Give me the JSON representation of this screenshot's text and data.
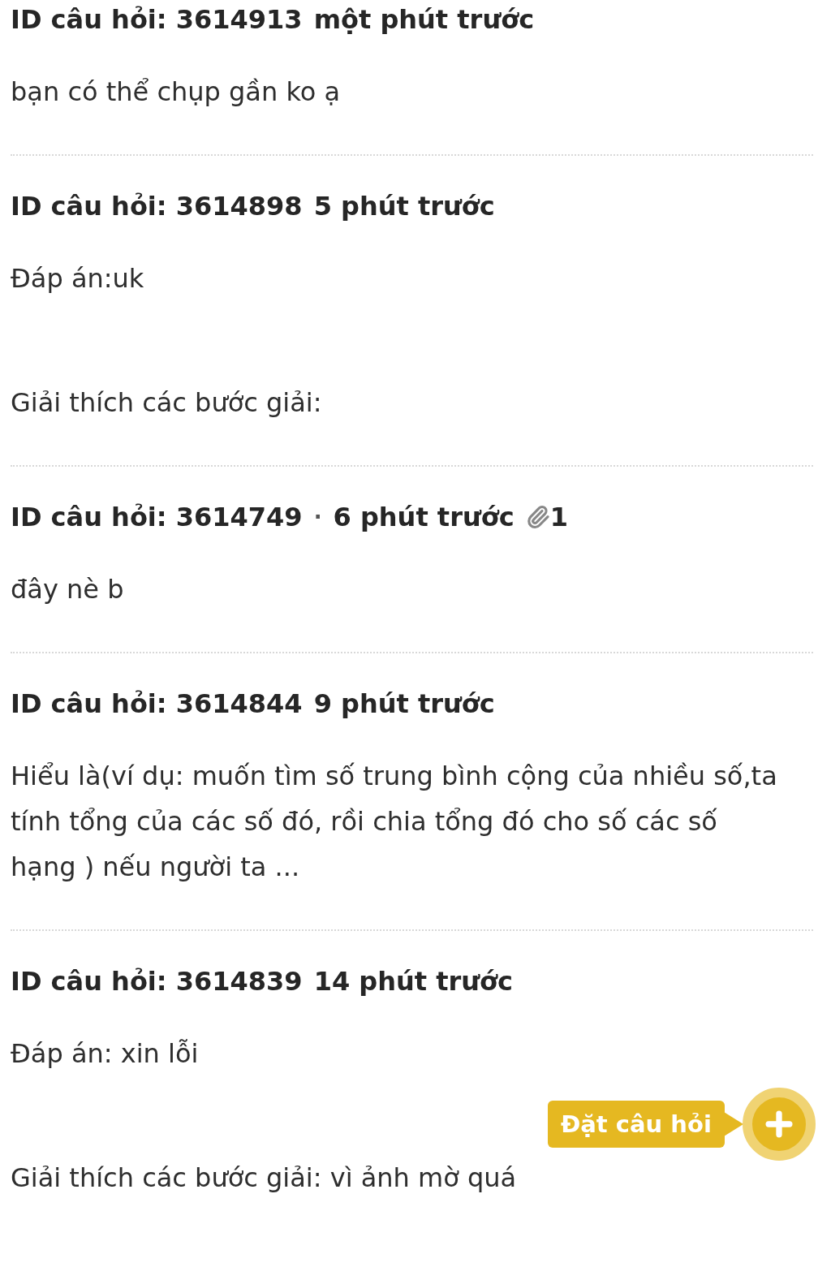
{
  "questions": [
    {
      "id_label": "ID câu hỏi: 3614913",
      "time": "một phút trước",
      "paragraphs": [
        "bạn có thể chụp gần ko ạ"
      ]
    },
    {
      "id_label": "ID câu hỏi: 3614898",
      "time": "5 phút trước",
      "paragraphs": [
        "Đáp án:uk",
        "Giải thích các bước giải:"
      ]
    },
    {
      "id_label": "ID câu hỏi: 3614749",
      "separator": "·",
      "time": "6 phút trước",
      "attachments": "1",
      "paragraphs": [
        "đây nè b"
      ]
    },
    {
      "id_label": "ID câu hỏi: 3614844",
      "time": "9 phút trước",
      "paragraphs": [
        "Hiểu là(ví dụ: muốn tìm số trung bình cộng của nhiều số,ta tính tổng của các số đó, rồi chia tổng đó cho số các số hạng ) nếu người ta ..."
      ]
    },
    {
      "id_label": "ID câu hỏi: 3614839",
      "time": "14 phút trước",
      "paragraphs": [
        "Đáp án: xin lỗi",
        "Giải thích các bước giải: vì ảnh mờ quá"
      ]
    }
  ],
  "ask_button": {
    "label": "Đặt câu hỏi"
  }
}
